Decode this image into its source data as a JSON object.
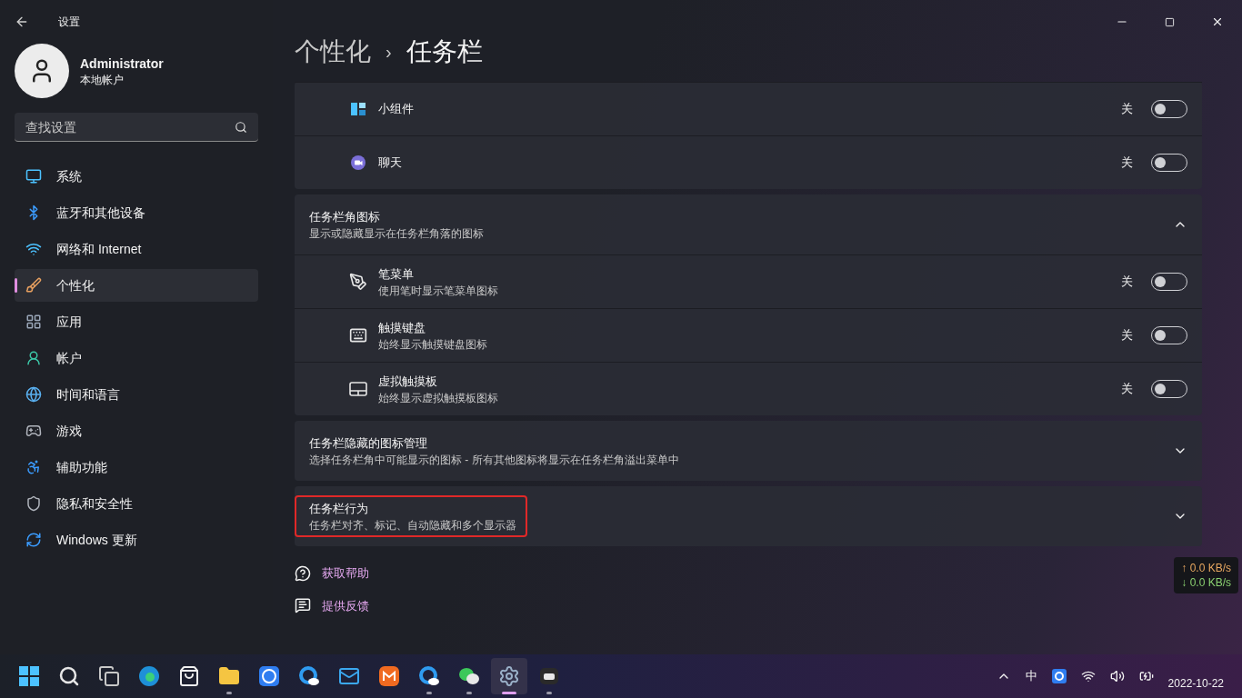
{
  "window": {
    "title": "设置"
  },
  "user": {
    "name": "Administrator",
    "account_type": "本地帐户"
  },
  "search": {
    "placeholder": "查找设置"
  },
  "nav": [
    {
      "label": "系统",
      "selected": false
    },
    {
      "label": "蓝牙和其他设备",
      "selected": false
    },
    {
      "label": "网络和 Internet",
      "selected": false
    },
    {
      "label": "个性化",
      "selected": true
    },
    {
      "label": "应用",
      "selected": false
    },
    {
      "label": "帐户",
      "selected": false
    },
    {
      "label": "时间和语言",
      "selected": false
    },
    {
      "label": "游戏",
      "selected": false
    },
    {
      "label": "辅助功能",
      "selected": false
    },
    {
      "label": "隐私和安全性",
      "selected": false
    },
    {
      "label": "Windows 更新",
      "selected": false
    }
  ],
  "breadcrumb": {
    "parent": "个性化",
    "separator": "›",
    "current": "任务栏"
  },
  "sections": [
    {
      "kind": "list",
      "items": [
        {
          "title": "小组件",
          "state_label": "关",
          "on": false
        },
        {
          "title": "聊天",
          "state_label": "关",
          "on": false
        }
      ]
    },
    {
      "kind": "expander",
      "title": "任务栏角图标",
      "description": "显示或隐藏显示在任务栏角落的图标",
      "expanded": true,
      "highlighted": false,
      "items": [
        {
          "title": "笔菜单",
          "description": "使用笔时显示笔菜单图标",
          "state_label": "关",
          "on": false
        },
        {
          "title": "触摸键盘",
          "description": "始终显示触摸键盘图标",
          "state_label": "关",
          "on": false
        },
        {
          "title": "虚拟触摸板",
          "description": "始终显示虚拟触摸板图标",
          "state_label": "关",
          "on": false
        }
      ]
    },
    {
      "kind": "expander",
      "title": "任务栏隐藏的图标管理",
      "description": "选择任务栏角中可能显示的图标 - 所有其他图标将显示在任务栏角溢出菜单中",
      "expanded": false,
      "highlighted": false
    },
    {
      "kind": "expander",
      "title": "任务栏行为",
      "description": "任务栏对齐、标记、自动隐藏和多个显示器",
      "expanded": false,
      "highlighted": true
    }
  ],
  "links": [
    {
      "label": "获取帮助"
    },
    {
      "label": "提供反馈"
    }
  ],
  "net_speed": {
    "up": "↑ 0.0 KB/s",
    "down": "↓ 0.0 KB/s"
  },
  "taskbar": {
    "apps": [
      {
        "running": false,
        "active": false
      },
      {
        "running": false,
        "active": false
      },
      {
        "running": false,
        "active": false
      },
      {
        "running": false,
        "active": false
      },
      {
        "running": false,
        "active": false
      },
      {
        "running": true,
        "active": false
      },
      {
        "running": false,
        "active": false
      },
      {
        "running": false,
        "active": false
      },
      {
        "running": false,
        "active": false
      },
      {
        "running": false,
        "active": false
      },
      {
        "running": true,
        "active": false
      },
      {
        "running": true,
        "active": false
      },
      {
        "running": true,
        "active": true
      },
      {
        "running": true,
        "active": false
      }
    ],
    "ime": "中",
    "date": "2022-10-22"
  }
}
